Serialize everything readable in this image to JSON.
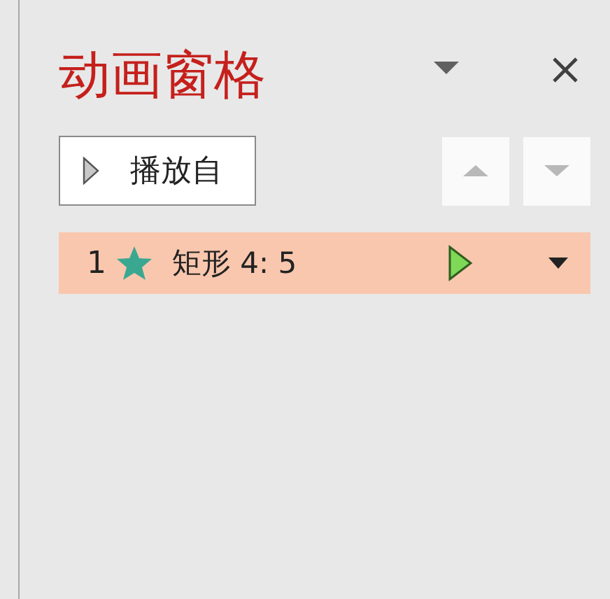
{
  "pane": {
    "title": "动画窗格"
  },
  "play_button": {
    "label": "播放自"
  },
  "items": [
    {
      "number": "1",
      "name": "矩形 4: 5",
      "selected": true
    }
  ]
}
